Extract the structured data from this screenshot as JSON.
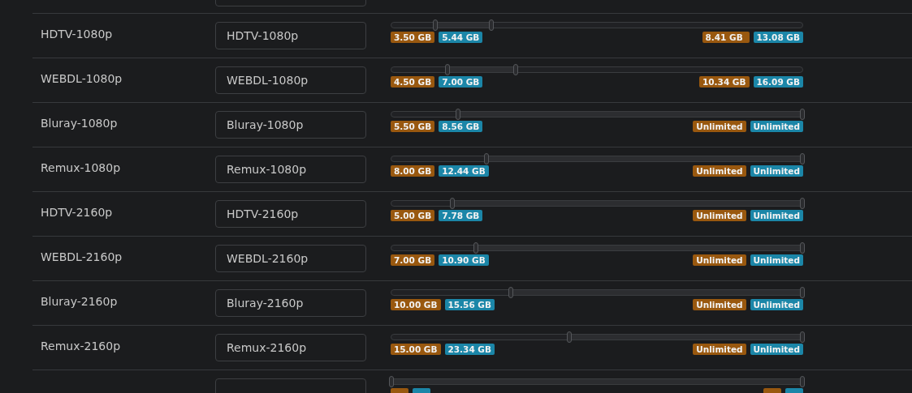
{
  "rows": [
    {
      "name": "HDTV-1080p",
      "title": "HDTV-1080p",
      "min": {
        "level": 0.106
      },
      "max": {
        "level": 0.244
      },
      "min_badges": [
        {
          "text": "3.50 GB",
          "color": "#99580f"
        },
        {
          "text": "5.44 GB",
          "color": "#1b86a8"
        }
      ],
      "max_badges": [
        {
          "text": "8.41 GB",
          "color": "#99580f"
        },
        {
          "text": "13.08 GB",
          "color": "#1b86a8"
        }
      ]
    },
    {
      "name": "WEBDL-1080p",
      "title": "WEBDL-1080p",
      "min": {
        "level": 0.136
      },
      "max": {
        "level": 0.303
      },
      "min_badges": [
        {
          "text": "4.50 GB",
          "color": "#99580f"
        },
        {
          "text": "7.00 GB",
          "color": "#1b86a8"
        }
      ],
      "max_badges": [
        {
          "text": "10.34 GB",
          "color": "#99580f"
        },
        {
          "text": "16.09 GB",
          "color": "#1b86a8"
        }
      ]
    },
    {
      "name": "Bluray-1080p",
      "title": "Bluray-1080p",
      "min": {
        "level": 0.163
      },
      "max": {
        "level": 1
      },
      "min_badges": [
        {
          "text": "5.50 GB",
          "color": "#99580f"
        },
        {
          "text": "8.56 GB",
          "color": "#1b86a8"
        }
      ],
      "max_badges": [
        {
          "text": "Unlimited",
          "color": "#99580f"
        },
        {
          "text": "Unlimited",
          "color": "#1b86a8"
        }
      ]
    },
    {
      "name": "Remux-1080p",
      "title": "Remux-1080p",
      "min": {
        "level": 0.232
      },
      "max": {
        "level": 1
      },
      "min_badges": [
        {
          "text": "8.00 GB",
          "color": "#99580f"
        },
        {
          "text": "12.44 GB",
          "color": "#1b86a8"
        }
      ],
      "max_badges": [
        {
          "text": "Unlimited",
          "color": "#99580f"
        },
        {
          "text": "Unlimited",
          "color": "#1b86a8"
        }
      ]
    },
    {
      "name": "HDTV-2160p",
      "title": "HDTV-2160p",
      "min": {
        "level": 0.148
      },
      "max": {
        "level": 1
      },
      "min_badges": [
        {
          "text": "5.00 GB",
          "color": "#99580f"
        },
        {
          "text": "7.78 GB",
          "color": "#1b86a8"
        }
      ],
      "max_badges": [
        {
          "text": "Unlimited",
          "color": "#99580f"
        },
        {
          "text": "Unlimited",
          "color": "#1b86a8"
        }
      ]
    },
    {
      "name": "WEBDL-2160p",
      "title": "WEBDL-2160p",
      "min": {
        "level": 0.205
      },
      "max": {
        "level": 1
      },
      "min_badges": [
        {
          "text": "7.00 GB",
          "color": "#99580f"
        },
        {
          "text": "10.90 GB",
          "color": "#1b86a8"
        }
      ],
      "max_badges": [
        {
          "text": "Unlimited",
          "color": "#99580f"
        },
        {
          "text": "Unlimited",
          "color": "#1b86a8"
        }
      ]
    },
    {
      "name": "Bluray-2160p",
      "title": "Bluray-2160p",
      "min": {
        "level": 0.29
      },
      "max": {
        "level": 1
      },
      "min_badges": [
        {
          "text": "10.00 GB",
          "color": "#99580f"
        },
        {
          "text": "15.56 GB",
          "color": "#1b86a8"
        }
      ],
      "max_badges": [
        {
          "text": "Unlimited",
          "color": "#99580f"
        },
        {
          "text": "Unlimited",
          "color": "#1b86a8"
        }
      ]
    },
    {
      "name": "Remux-2160p",
      "title": "Remux-2160p",
      "min": {
        "level": 0.433
      },
      "max": {
        "level": 1
      },
      "min_badges": [
        {
          "text": "15.00 GB",
          "color": "#99580f"
        },
        {
          "text": "23.34 GB",
          "color": "#1b86a8"
        }
      ],
      "max_badges": [
        {
          "text": "Unlimited",
          "color": "#99580f"
        },
        {
          "text": "Unlimited",
          "color": "#1b86a8"
        }
      ]
    },
    {
      "min": {
        "level": 0
      },
      "max": {
        "level": 1
      },
      "min_badges": [
        {
          "color": "#99580f"
        },
        {
          "color": "#1b86a8"
        }
      ],
      "max_badges": [
        {
          "color": "#99580f"
        },
        {
          "color": "#1b86a8"
        }
      ]
    }
  ]
}
